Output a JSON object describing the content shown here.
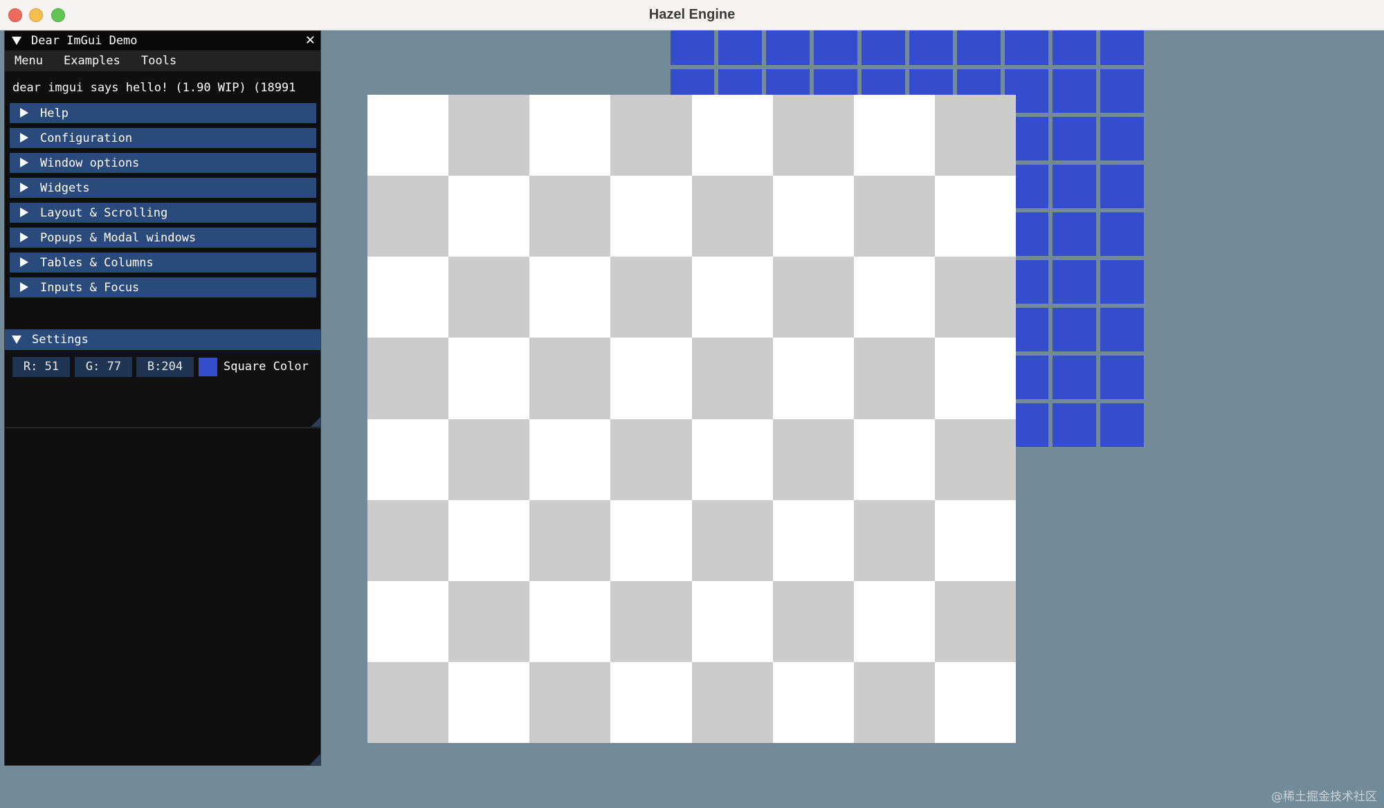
{
  "window": {
    "title": "Hazel Engine"
  },
  "demo_window": {
    "title": "Dear ImGui Demo",
    "close_glyph": "✕",
    "menu": [
      "Menu",
      "Examples",
      "Tools"
    ],
    "hello": "dear imgui says hello! (1.90 WIP) (18991",
    "headers": [
      "Help",
      "Configuration",
      "Window options",
      "Widgets",
      "Layout & Scrolling",
      "Popups & Modal windows",
      "Tables & Columns",
      "Inputs & Focus"
    ]
  },
  "settings": {
    "title": "Settings",
    "r_label": "R: 51",
    "g_label": "G: 77",
    "b_label": "B:204",
    "color_label": "Square Color",
    "square_color": "#334dcc"
  },
  "scene": {
    "background": "#738b98",
    "checker_light": "#ffffff",
    "checker_dark": "#cccccc",
    "blue_square_color": "#334dcc",
    "checker_size": 8,
    "blue_grid_cols": 10,
    "blue_grid_rows": 9
  },
  "watermark": "@稀土掘金技术社区"
}
